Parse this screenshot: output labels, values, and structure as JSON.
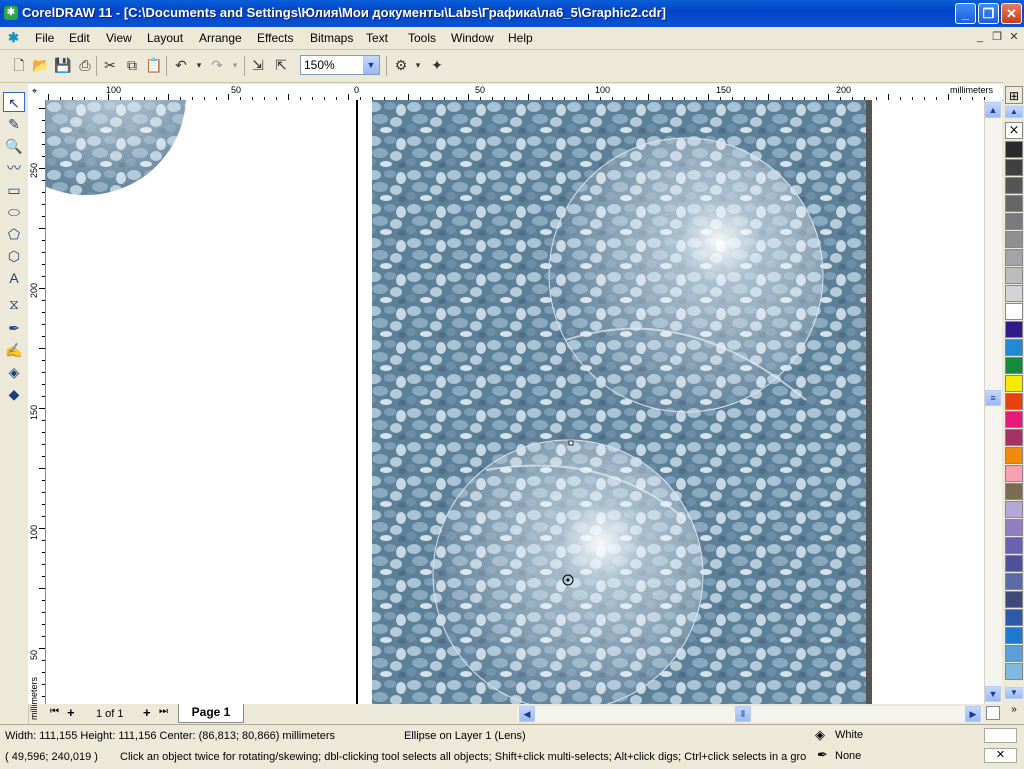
{
  "window": {
    "title": "CorelDRAW 11 - [C:\\Documents and Settings\\Юлия\\Мои документы\\Labs\\Графика\\ла6_5\\Graphic2.cdr]",
    "min": "_",
    "max": "❐",
    "close": "✕"
  },
  "menu": {
    "items": [
      "File",
      "Edit",
      "View",
      "Layout",
      "Arrange",
      "Effects",
      "Bitmaps",
      "Text",
      "Tools",
      "Window",
      "Help"
    ],
    "mdi": [
      "_",
      "❐",
      "✕"
    ]
  },
  "toolbar": {
    "zoom_value": "150%",
    "zoom_arrow": "▼"
  },
  "ruler": {
    "h_labels": [
      "100",
      "50",
      "0",
      "50",
      "100",
      "150",
      "200"
    ],
    "h_unit": "millimeters",
    "v_labels": [
      "250",
      "200",
      "150",
      "100",
      "50"
    ],
    "v_unit": "millimeters"
  },
  "page_nav": {
    "first": "⏮",
    "add_before": "+",
    "page_count": "1 of 1",
    "add_after": "+",
    "last": "⏭",
    "tab_label": "Page 1"
  },
  "palette": {
    "colors": [
      "#2b2b2b",
      "#404040",
      "#555555",
      "#666666",
      "#7a7a7a",
      "#8f8f8f",
      "#a4a4a4",
      "#bcbcbc",
      "#d4d4d4",
      "#ffffff",
      "#2e1a88",
      "#1f8bd6",
      "#138a3c",
      "#f8e900",
      "#e8410f",
      "#e8197a",
      "#a62f63",
      "#f08c0a",
      "#f7a1b5",
      "#7a6a4f",
      "#b4a8d6",
      "#8f7fc0",
      "#6a60b0",
      "#50509a",
      "#5a6aa6",
      "#404a7a",
      "#2f5aa8",
      "#1e7ad0",
      "#5aa0d8",
      "#80b8e0"
    ]
  },
  "status": {
    "dimensions": "Width: 111,155  Height: 111,156  Center: (86,813; 80,866)  millimeters",
    "object_info": "Ellipse on Layer 1  (Lens)",
    "fill_label": "White",
    "coords": "( 49,596; 240,019 )",
    "hint": "Click an object twice for rotating/skewing; dbl-clicking tool selects all objects; Shift+click multi-selects; Alt+click digs; Ctrl+click selects in a group",
    "outline_label": "None"
  }
}
